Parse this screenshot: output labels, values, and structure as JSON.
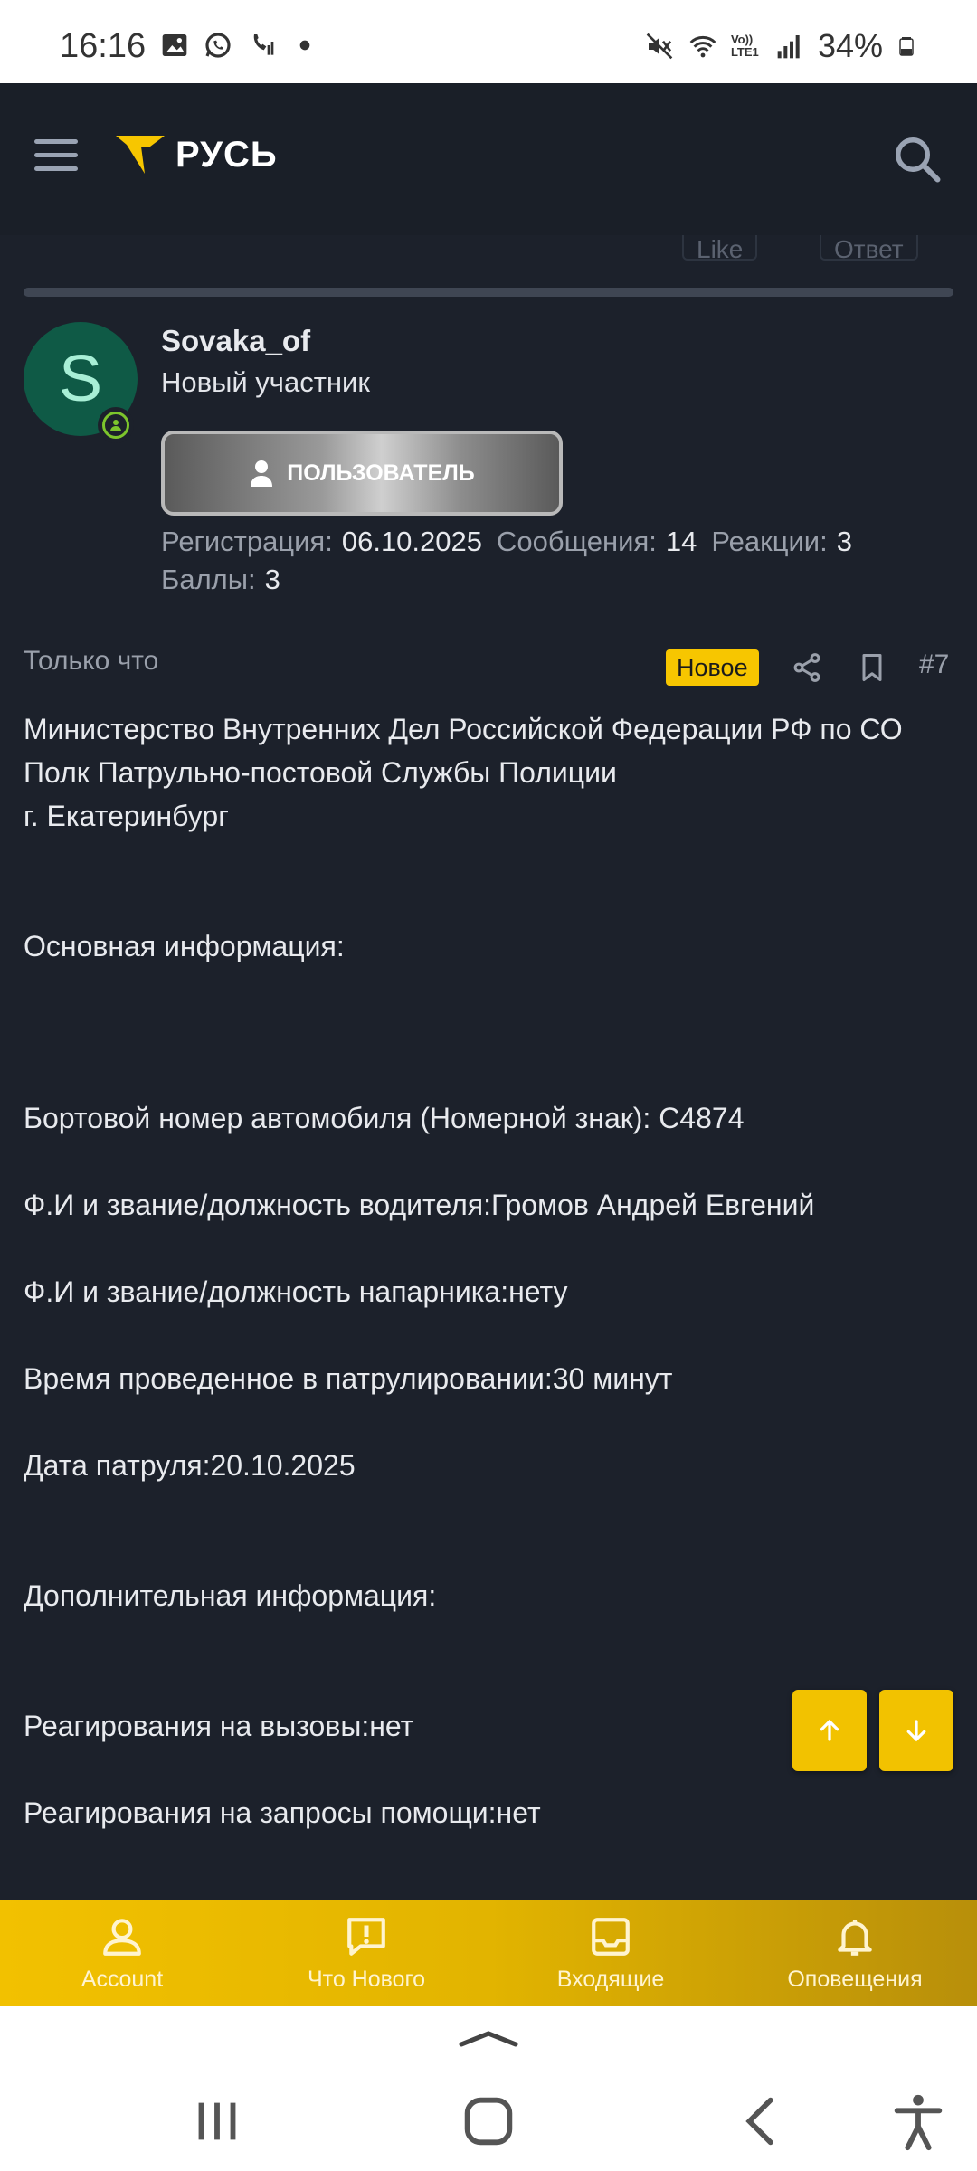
{
  "status_bar": {
    "time": "16:16",
    "battery": "34%",
    "left_icons": [
      "image-icon",
      "whatsapp-icon",
      "call-icon",
      "dot-icon"
    ],
    "right_icons": [
      "mute-icon",
      "wifi-icon",
      "volte-icon",
      "signal-icon",
      "battery-icon"
    ],
    "volte": "Vo)) LTE1"
  },
  "header": {
    "logo_text": "РУСЬ",
    "logo_color": "#f7c600"
  },
  "previous_post": {
    "like_label": "Like",
    "reply_label": "Ответ"
  },
  "author": {
    "avatar_letter": "S",
    "avatar_color": "#0f5a46",
    "username": "Sovaka_of",
    "title": "Новый участник",
    "role_badge": "ПОЛЬЗОВАТЕЛЬ",
    "stats": {
      "registration_label": "Регистрация:",
      "registration_value": "06.10.2025",
      "messages_label": "Сообщения:",
      "messages_value": "14",
      "reactions_label": "Реакции:",
      "reactions_value": "3",
      "points_label": "Баллы:",
      "points_value": "3"
    }
  },
  "post": {
    "time": "Только что",
    "new_badge": "Новое",
    "number": "#7",
    "lines": [
      "Министерство Внутренних Дел Российской Федерации РФ по СО",
      "Полк Патрульно-постовой Службы Полиции",
      "г. Екатеринбург",
      "Основная информация:",
      "Бортовой номер автомобиля (Номерной знак): С4874",
      "Ф.И и звание/должность водителя:Громов Андрей Евгений",
      "Ф.И и звание/должность напарника:нету",
      "Время проведенное в патрулировании:30 минут",
      "Дата патруля:20.10.2025",
      "Дополнительная информация:",
      "Реагирования на вызовы:нет",
      "Реагирования на запросы помощи:нет"
    ]
  },
  "bottom_nav": {
    "items": [
      {
        "label": "Account",
        "icon": "account-icon"
      },
      {
        "label": "Что Нового",
        "icon": "whats-new-icon"
      },
      {
        "label": "Входящие",
        "icon": "inbox-icon"
      },
      {
        "label": "Оповещения",
        "icon": "bell-icon"
      }
    ]
  }
}
